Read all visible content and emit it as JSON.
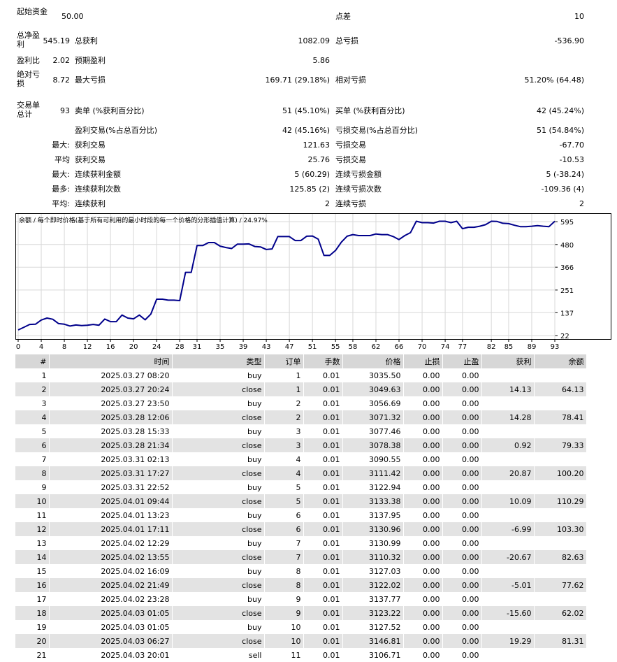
{
  "summary": {
    "initial_deposit_label": "起始资金",
    "initial_deposit_value": "50.00",
    "spread_label": "点差",
    "spread_value": "10",
    "net_profit_label": "总净盈利",
    "net_profit_value": "545.19",
    "gross_profit_label": "总获利",
    "gross_profit_value": "1082.09",
    "gross_loss_label": "总亏损",
    "gross_loss_value": "-536.90",
    "profit_factor_label": "盈利比",
    "profit_factor_value": "2.02",
    "expected_payoff_label": "预期盈利",
    "expected_payoff_value": "5.86",
    "absolute_drawdown_label": "绝对亏损",
    "absolute_drawdown_value": "8.72",
    "max_drawdown_label": "最大亏损",
    "max_drawdown_value": "169.71 (29.18%)",
    "relative_drawdown_label": "相对亏损",
    "relative_drawdown_value": "51.20% (64.48)",
    "total_trades_label": "交易单总计",
    "total_trades_value": "93",
    "short_label": "卖单 (%获利百分比)",
    "short_value": "51 (45.10%)",
    "long_label": "买单 (%获利百分比)",
    "long_value": "42 (45.24%)",
    "profit_trades_label": "盈利交易(%占总百分比)",
    "profit_trades_value": "42 (45.16%)",
    "loss_trades_label": "亏损交易(%占总百分比)",
    "loss_trades_value": "51 (54.84%)",
    "largest_prefix": "最大:",
    "largest_profit_label": "获利交易",
    "largest_profit_value": "121.63",
    "largest_loss_label": "亏损交易",
    "largest_loss_value": "-67.70",
    "average_prefix": "平均",
    "average_profit_label": "获利交易",
    "average_profit_value": "25.76",
    "average_loss_label": "亏损交易",
    "average_loss_value": "-10.53",
    "max_prefix": "最大:",
    "max_cons_wins_label": "连续获利金额",
    "max_cons_wins_value": "5 (60.29)",
    "max_cons_losses_label": "连续亏损金额",
    "max_cons_losses_value": "5 (-38.24)",
    "maximal_prefix": "最多:",
    "maximal_cons_profit_label": "连续获利次数",
    "maximal_cons_profit_value": "125.85 (2)",
    "maximal_cons_loss_label": "连续亏损次数",
    "maximal_cons_loss_value": "-109.36 (4)",
    "avg_cons_prefix": "平均:",
    "avg_cons_wins_label": "连续获利",
    "avg_cons_wins_value": "2",
    "avg_cons_losses_label": "连续亏损",
    "avg_cons_losses_value": "2"
  },
  "chart_data": {
    "type": "line",
    "title": "余额 / 每个即时价格(基于所有可利用的最小时段的每一个价格的分形插值计算) / 24.97%",
    "x_ticks": [
      "0",
      "4",
      "8",
      "12",
      "16",
      "20",
      "24",
      "28",
      "31",
      "35",
      "39",
      "43",
      "47",
      "51",
      "55",
      "58",
      "62",
      "66",
      "70",
      "74",
      "77",
      "82",
      "85",
      "89",
      "93"
    ],
    "y_ticks": [
      "595",
      "480",
      "366",
      "251",
      "137",
      "22"
    ],
    "xlim": [
      0,
      93
    ],
    "ylim": [
      22,
      620
    ],
    "colors": {
      "line": "#00008b",
      "grid": "#d8d8d8"
    },
    "x": [
      0,
      1,
      2,
      3,
      4,
      5,
      6,
      7,
      8,
      9,
      10,
      11,
      12,
      13,
      14,
      15,
      16,
      17,
      18,
      19,
      20,
      21,
      22,
      23,
      24,
      25,
      26,
      27,
      28,
      29,
      30,
      31,
      32,
      33,
      34,
      35,
      36,
      37,
      38,
      39,
      40,
      41,
      42,
      43,
      44,
      45,
      46,
      47,
      48,
      49,
      50,
      51,
      52,
      53,
      54,
      55,
      56,
      57,
      58,
      59,
      60,
      61,
      62,
      63,
      64,
      65,
      66,
      67,
      68,
      69,
      70,
      71,
      72,
      73,
      74,
      75,
      76,
      77,
      78,
      79,
      80,
      81,
      82,
      83,
      84,
      85,
      86,
      87,
      88,
      89,
      90,
      91,
      92,
      93
    ],
    "y": [
      50,
      64,
      78,
      79,
      100,
      110,
      104,
      82,
      79,
      70,
      75,
      72,
      74,
      78,
      74,
      105,
      92,
      92,
      125,
      110,
      106,
      125,
      101,
      130,
      205,
      205,
      200,
      200,
      198,
      340,
      340,
      475,
      475,
      490,
      490,
      472,
      465,
      460,
      482,
      482,
      483,
      470,
      468,
      455,
      458,
      520,
      520,
      520,
      500,
      500,
      522,
      523,
      507,
      425,
      425,
      450,
      492,
      522,
      530,
      525,
      525,
      525,
      533,
      530,
      530,
      520,
      505,
      525,
      540,
      597,
      590,
      590,
      588,
      597,
      597,
      590,
      597,
      560,
      567,
      567,
      572,
      580,
      597,
      596,
      587,
      585,
      577,
      570,
      570,
      572,
      575,
      572,
      570,
      597
    ]
  },
  "table": {
    "headers": [
      "#",
      "时间",
      "类型",
      "订单",
      "手数",
      "价格",
      "止损",
      "止盈",
      "获利",
      "余额"
    ],
    "rows": [
      [
        "1",
        "2025.03.27 08:20",
        "buy",
        "1",
        "0.01",
        "3035.50",
        "0.00",
        "0.00",
        "",
        ""
      ],
      [
        "2",
        "2025.03.27 20:24",
        "close",
        "1",
        "0.01",
        "3049.63",
        "0.00",
        "0.00",
        "14.13",
        "64.13"
      ],
      [
        "3",
        "2025.03.27 23:50",
        "buy",
        "2",
        "0.01",
        "3056.69",
        "0.00",
        "0.00",
        "",
        ""
      ],
      [
        "4",
        "2025.03.28 12:06",
        "close",
        "2",
        "0.01",
        "3071.32",
        "0.00",
        "0.00",
        "14.28",
        "78.41"
      ],
      [
        "5",
        "2025.03.28 15:33",
        "buy",
        "3",
        "0.01",
        "3077.46",
        "0.00",
        "0.00",
        "",
        ""
      ],
      [
        "6",
        "2025.03.28 21:34",
        "close",
        "3",
        "0.01",
        "3078.38",
        "0.00",
        "0.00",
        "0.92",
        "79.33"
      ],
      [
        "7",
        "2025.03.31 02:13",
        "buy",
        "4",
        "0.01",
        "3090.55",
        "0.00",
        "0.00",
        "",
        ""
      ],
      [
        "8",
        "2025.03.31 17:27",
        "close",
        "4",
        "0.01",
        "3111.42",
        "0.00",
        "0.00",
        "20.87",
        "100.20"
      ],
      [
        "9",
        "2025.03.31 22:52",
        "buy",
        "5",
        "0.01",
        "3122.94",
        "0.00",
        "0.00",
        "",
        ""
      ],
      [
        "10",
        "2025.04.01 09:44",
        "close",
        "5",
        "0.01",
        "3133.38",
        "0.00",
        "0.00",
        "10.09",
        "110.29"
      ],
      [
        "11",
        "2025.04.01 13:23",
        "buy",
        "6",
        "0.01",
        "3137.95",
        "0.00",
        "0.00",
        "",
        ""
      ],
      [
        "12",
        "2025.04.01 17:11",
        "close",
        "6",
        "0.01",
        "3130.96",
        "0.00",
        "0.00",
        "-6.99",
        "103.30"
      ],
      [
        "13",
        "2025.04.02 12:29",
        "buy",
        "7",
        "0.01",
        "3130.99",
        "0.00",
        "0.00",
        "",
        ""
      ],
      [
        "14",
        "2025.04.02 13:55",
        "close",
        "7",
        "0.01",
        "3110.32",
        "0.00",
        "0.00",
        "-20.67",
        "82.63"
      ],
      [
        "15",
        "2025.04.02 16:09",
        "buy",
        "8",
        "0.01",
        "3127.03",
        "0.00",
        "0.00",
        "",
        ""
      ],
      [
        "16",
        "2025.04.02 21:49",
        "close",
        "8",
        "0.01",
        "3122.02",
        "0.00",
        "0.00",
        "-5.01",
        "77.62"
      ],
      [
        "17",
        "2025.04.02 23:28",
        "buy",
        "9",
        "0.01",
        "3137.77",
        "0.00",
        "0.00",
        "",
        ""
      ],
      [
        "18",
        "2025.04.03 01:05",
        "close",
        "9",
        "0.01",
        "3123.22",
        "0.00",
        "0.00",
        "-15.60",
        "62.02"
      ],
      [
        "19",
        "2025.04.03 01:05",
        "buy",
        "10",
        "0.01",
        "3127.52",
        "0.00",
        "0.00",
        "",
        ""
      ],
      [
        "20",
        "2025.04.03 06:27",
        "close",
        "10",
        "0.01",
        "3146.81",
        "0.00",
        "0.00",
        "19.29",
        "81.31"
      ],
      [
        "21",
        "2025.04.03 20:01",
        "sell",
        "11",
        "0.01",
        "3106.71",
        "0.00",
        "0.00",
        "",
        ""
      ]
    ]
  }
}
